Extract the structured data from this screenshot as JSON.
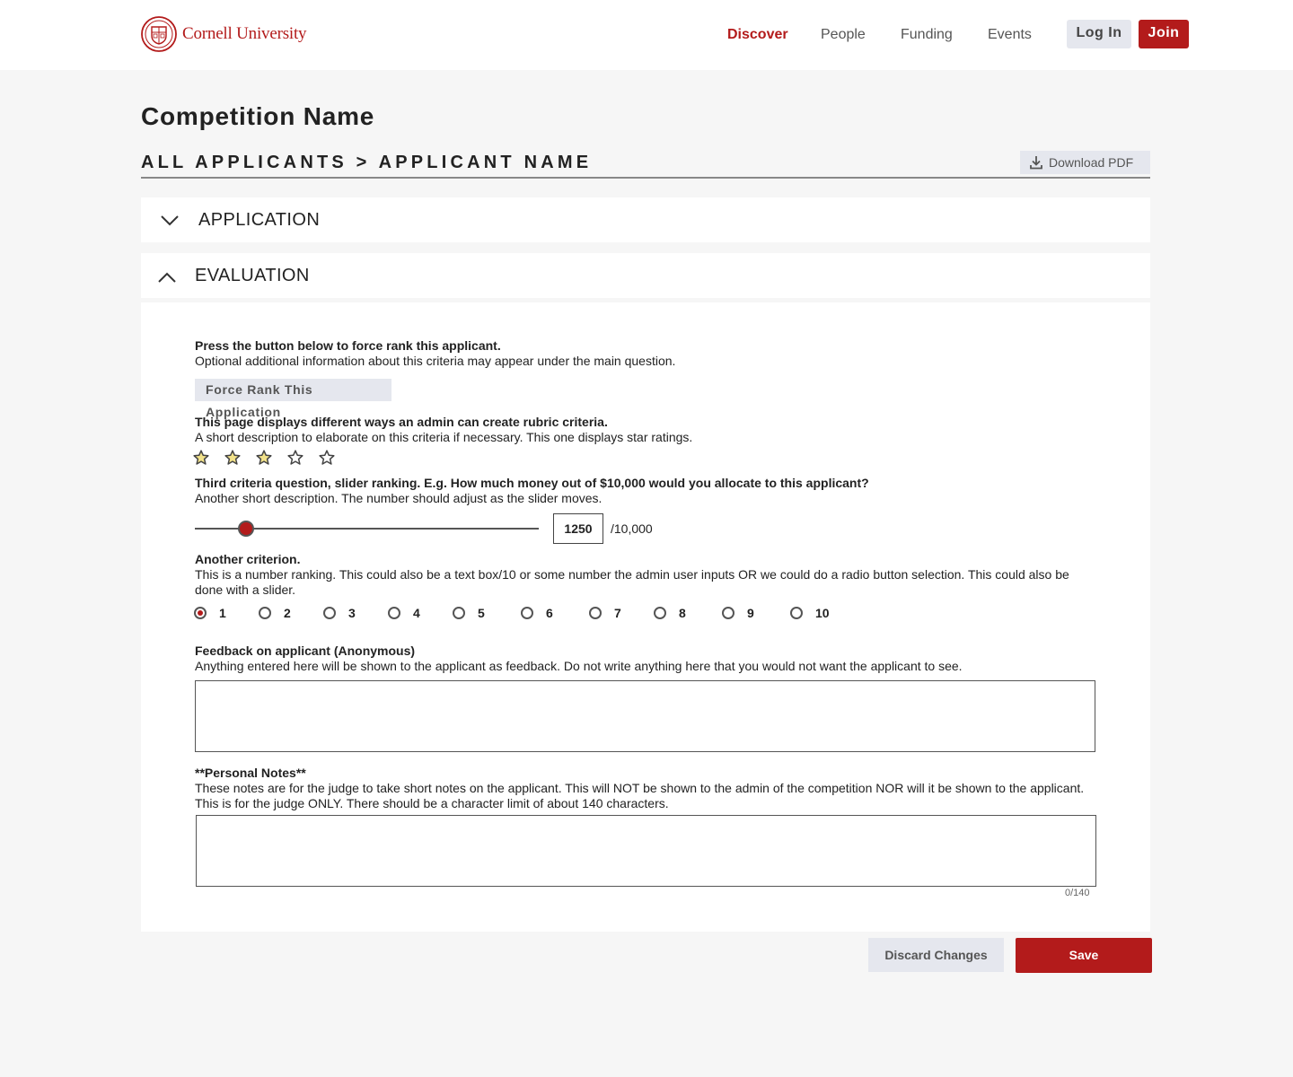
{
  "header": {
    "logo_text": "Cornell University",
    "nav": [
      {
        "label": "Discover",
        "active": true
      },
      {
        "label": "People",
        "active": false
      },
      {
        "label": "Funding",
        "active": false
      },
      {
        "label": "Events",
        "active": false
      }
    ],
    "login_label": "Log In",
    "join_label": "Join"
  },
  "page": {
    "title": "Competition Name",
    "breadcrumb": "ALL APPLICANTS > APPLICANT NAME",
    "download_label": "Download PDF"
  },
  "sections": {
    "application": {
      "label": "APPLICATION",
      "expanded": false
    },
    "evaluation": {
      "label": "EVALUATION",
      "expanded": true
    }
  },
  "evaluation": {
    "force_rank": {
      "question": "Press the button below to force rank this applicant.",
      "description": "Optional additional information about this criteria may appear under the main question.",
      "button_label": "Force Rank This Application"
    },
    "star_rating": {
      "question": "This page displays different ways an admin can create rubric criteria.",
      "description": "A short description to elaborate on this criteria if necessary. This one displays star ratings.",
      "rating": 3,
      "max": 5
    },
    "slider": {
      "question": "Third criteria question, slider ranking. E.g. How much money out of $10,000 would you allocate to this applicant?",
      "description": "Another short description. The number should adjust as the slider moves.",
      "value": "1250",
      "max_label": "/10,000",
      "fraction": 0.125
    },
    "number_ranking": {
      "question": "Another criterion.",
      "description": "This is a number ranking. This could also be a text box/10 or some number the admin user inputs OR we could do a radio button selection. This could also be done with a slider.",
      "options": [
        "1",
        "2",
        "3",
        "4",
        "5",
        "6",
        "7",
        "8",
        "9",
        "10"
      ],
      "selected": "1"
    },
    "feedback": {
      "question": "Feedback on applicant (Anonymous)",
      "description": "Anything entered here will be shown to the applicant as feedback. Do not write anything here that you would not want the applicant to see.",
      "value": ""
    },
    "notes": {
      "question": "**Personal Notes**",
      "description": "These notes are for the judge to take short notes on the applicant. This will NOT be shown to the admin of the competition NOR will it be shown to the applicant. This is for the judge ONLY. There should be a character limit of about 140 characters.",
      "value": "",
      "char_count": "0/140"
    }
  },
  "actions": {
    "discard_label": "Discard Changes",
    "save_label": "Save"
  },
  "colors": {
    "brand": "#b31b1b",
    "button_gray": "#e5e7ee",
    "star_fill": "#f2e28a"
  }
}
